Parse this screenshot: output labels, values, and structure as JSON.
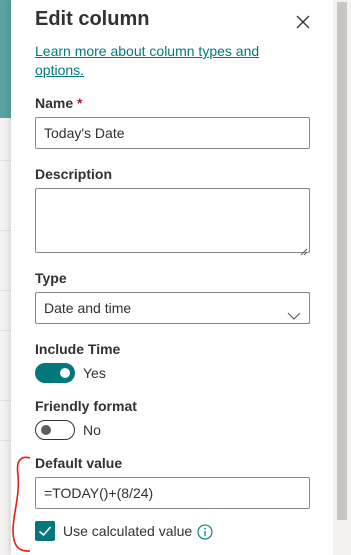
{
  "panel": {
    "title": "Edit column",
    "learn_more_link": "Learn more about column types and options."
  },
  "fields": {
    "name": {
      "label": "Name",
      "required_mark": "*",
      "value": "Today's Date"
    },
    "description": {
      "label": "Description",
      "value": ""
    },
    "type": {
      "label": "Type",
      "selected": "Date and time"
    },
    "include_time": {
      "label": "Include Time",
      "state_text": "Yes",
      "on": true
    },
    "friendly_format": {
      "label": "Friendly format",
      "state_text": "No",
      "on": false
    },
    "default_value": {
      "label": "Default value",
      "value": "=TODAY()+(8/24)"
    },
    "use_calculated": {
      "label": "Use calculated value",
      "checked": true
    }
  },
  "colors": {
    "accent": "#03787c",
    "annotation": "#e0201b"
  },
  "icons": {
    "close": "close-icon",
    "chevron": "chevron-down-icon",
    "info": "info-icon",
    "check": "checkmark-icon"
  }
}
